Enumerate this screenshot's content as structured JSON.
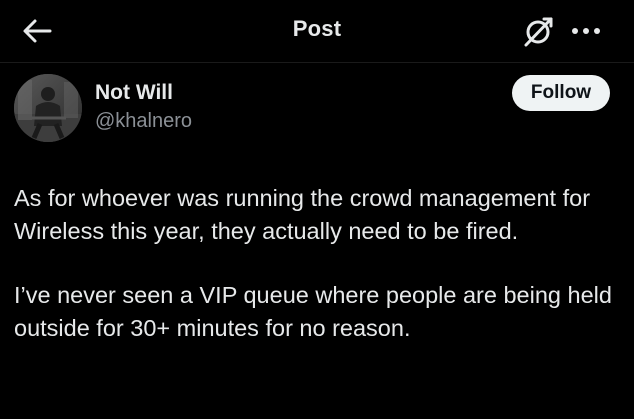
{
  "header": {
    "title": "Post",
    "back_icon": "arrow-left-icon",
    "grok_icon": "grok-icon",
    "more_icon": "more-horizontal-icon"
  },
  "author": {
    "display_name": "Not Will",
    "handle": "@khalnero",
    "follow_label": "Follow"
  },
  "tweet": {
    "paragraphs": [
      "As for whoever was running the crowd management for Wireless this year, they actually need to be fired.",
      "I’ve never seen a VIP queue where people are being held outside for 30+ minutes for no reason."
    ]
  },
  "colors": {
    "background": "#000000",
    "text": "#e7e9ea",
    "secondary_text": "#8b9096",
    "follow_bg": "#eff3f4"
  }
}
